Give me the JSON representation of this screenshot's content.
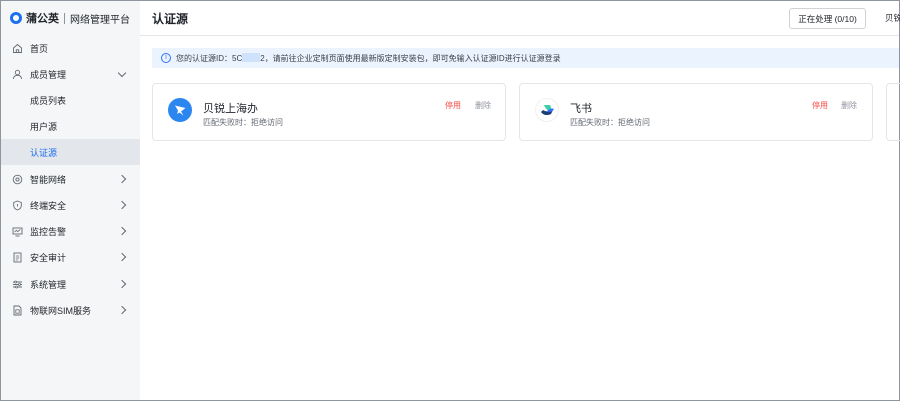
{
  "brand": {
    "name": "蒲公英",
    "subtitle": "网络管理平台",
    "color": "#1c6ef2"
  },
  "sidebar": {
    "items": [
      {
        "label": "首页",
        "icon": "home-icon"
      },
      {
        "label": "成员管理",
        "icon": "user-icon",
        "expanded": true
      },
      {
        "label": "成员列表",
        "sub": true
      },
      {
        "label": "用户源",
        "sub": true
      },
      {
        "label": "认证源",
        "sub": true,
        "active": true
      },
      {
        "label": "智能网络",
        "icon": "smart-network-icon"
      },
      {
        "label": "终端安全",
        "icon": "shield-icon"
      },
      {
        "label": "监控告警",
        "icon": "monitor-icon"
      },
      {
        "label": "安全审计",
        "icon": "audit-icon"
      },
      {
        "label": "系统管理",
        "icon": "settings-icon"
      },
      {
        "label": "物联网SIM服务",
        "icon": "sim-icon"
      }
    ]
  },
  "header": {
    "title": "认证源",
    "processing_label": "正在处理 (0/10)",
    "user_label": "贝锐"
  },
  "info": {
    "prefix": "您的认证源ID：",
    "id_start": "5C",
    "id_end": "2",
    "suffix": "，请前往企业定制页面使用最新版定制安装包，即可免输入认证源ID进行认证源登录"
  },
  "cards": [
    {
      "name": "贝锐上海办",
      "meta": "匹配失败时：拒绝访问",
      "disable": "停用",
      "delete": "删除",
      "logo_color": "#2b86f0"
    },
    {
      "name": "飞书",
      "meta": "匹配失败时：拒绝访问",
      "disable": "停用",
      "delete": "删除",
      "logo_color": "#ffffff"
    }
  ]
}
